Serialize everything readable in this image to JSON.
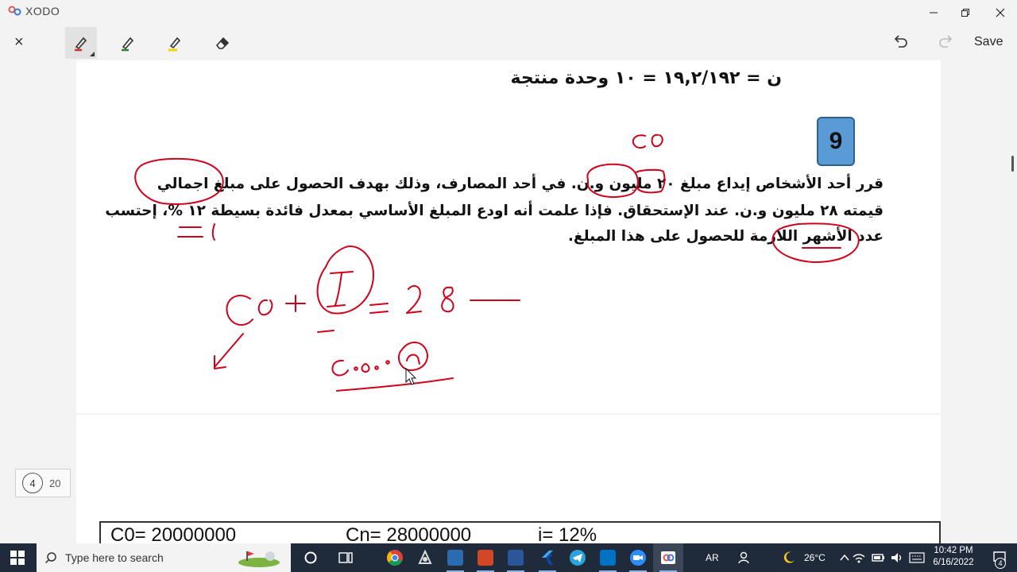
{
  "app": {
    "name": "XODO",
    "window_controls": {
      "minimize": "—",
      "maximize": "❐",
      "close": "✕"
    }
  },
  "toolbar": {
    "close_label": "×",
    "save_label": "Save",
    "tools": [
      {
        "name": "pen-red",
        "color": "#d32f2f",
        "active": true
      },
      {
        "name": "pen-green",
        "color": "#2e7d32",
        "active": false
      },
      {
        "name": "highlighter-yellow",
        "color": "#f2d600",
        "active": false
      },
      {
        "name": "eraser",
        "color": "#333333",
        "active": false
      }
    ]
  },
  "document": {
    "equation_line": "ن = ١٩,٢/١٩٢  = ١٠ وحدة منتجة",
    "problem_number": "9",
    "paragraph": [
      "قرر أحد الأشخاص إيداع مبلغ ٢٠ مليون و.ن. في أحد المصارف، وذلك بهدف الحصول على مبلغ اجمالي",
      "قيمته ٢٨ مليون و.ن. عند  الإستحقاق. فإذا علمت أنه اودع المبلغ الأساسي بمعدل فائدة بسيطة ١٢ %، إحتسب",
      "عدد الأشهر اللازمة للحصول على هذا المبلغ."
    ],
    "formula_row": {
      "c0": "C0= 20000000",
      "cn": "Cn= 28000000",
      "i": "i= 12%"
    }
  },
  "pager": {
    "current": "4",
    "total": "20"
  },
  "taskbar": {
    "search_placeholder": "Type here to search",
    "language": "AR",
    "temperature": "26°C",
    "time": "10:42 PM",
    "date": "6/16/2022",
    "notification_count": "4"
  },
  "colors": {
    "ink_red": "#d0021b",
    "badge_blue": "#5b9bd5",
    "taskbar": "#1f2a3a"
  }
}
